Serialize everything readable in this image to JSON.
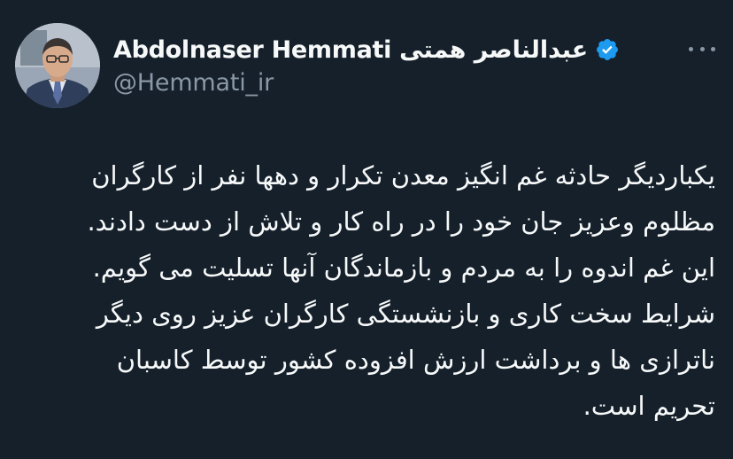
{
  "author": {
    "display_name": "Abdolnaser Hemmati عبدالناصر همتی",
    "handle": "@Hemmati_ir",
    "verified": true,
    "verified_icon": "verified-badge-icon",
    "avatar_icon": "profile-photo"
  },
  "menu": {
    "icon": "more-options-icon"
  },
  "tweet": {
    "lines": [
      "یکباردیگر حادثه غم انگیز معدن تکرار و دهها نفر از کارگران",
      "مظلوم وعزیز جان خود را در راه کار و تلاش از دست دادند.",
      "این غم اندوه را به مردم و بازماندگان آنها تسلیت می گویم.",
      "شرایط سخت کاری و بازنشستگی کارگران عزیز روی دیگر",
      "ناترازی ها و برداشت ارزش افزوده کشور توسط کاسبان",
      "تحریم است."
    ]
  },
  "colors": {
    "background": "#15202b",
    "text": "#f7f9f9",
    "secondary_text": "#8b98a5",
    "verified_blue": "#1d9bf0"
  }
}
